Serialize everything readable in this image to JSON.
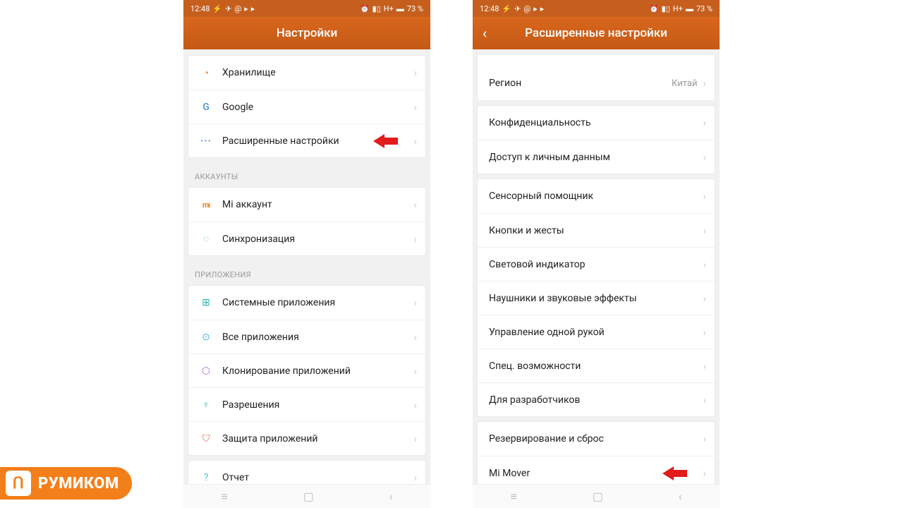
{
  "statusbar": {
    "time": "12:48",
    "net": "H+",
    "battery": "73 %"
  },
  "brand": {
    "text": "РУМИКОМ"
  },
  "left": {
    "title": "Настройки",
    "group1": [
      {
        "icon": "storage-icon",
        "glyph": "◔",
        "cls": "ic-orange",
        "label": "Хранилище"
      },
      {
        "icon": "google-icon",
        "glyph": "G",
        "cls": "ic-blue ic-google",
        "label": "Google"
      },
      {
        "icon": "more-icon",
        "glyph": "···",
        "cls": "ic-dots",
        "label": "Расширенные настройки",
        "arrow": true
      }
    ],
    "section_accounts": "АККАУНТЫ",
    "group2": [
      {
        "icon": "mi-icon",
        "glyph": "mı",
        "cls": "ic-mi",
        "label": "Mi аккаунт"
      },
      {
        "icon": "sync-icon",
        "glyph": "◌",
        "cls": "ic-cyan",
        "label": "Синхронизация"
      }
    ],
    "section_apps": "ПРИЛОЖЕНИЯ",
    "group3": [
      {
        "icon": "apps-icon",
        "glyph": "⊞",
        "cls": "ic-teal",
        "label": "Системные приложения"
      },
      {
        "icon": "allapps-icon",
        "glyph": "⊙",
        "cls": "ic-cyan",
        "label": "Все приложения"
      },
      {
        "icon": "clone-icon",
        "glyph": "⬡",
        "cls": "ic-purple",
        "label": "Клонирование приложений"
      },
      {
        "icon": "permissions-icon",
        "glyph": "♀",
        "cls": "ic-teal",
        "label": "Разрешения"
      },
      {
        "icon": "shield-icon",
        "glyph": "⛉",
        "cls": "ic-red",
        "label": "Защита приложений"
      }
    ],
    "group4": [
      {
        "icon": "report-icon",
        "glyph": "?",
        "cls": "ic-cyan",
        "label": "Отчет"
      }
    ]
  },
  "right": {
    "title": "Расширенные настройки",
    "group0": [
      {
        "label": "Регион",
        "value": "Китай"
      }
    ],
    "group1": [
      {
        "label": "Конфиденциальность"
      },
      {
        "label": "Доступ к личным данным"
      }
    ],
    "group2": [
      {
        "label": "Сенсорный помощник"
      },
      {
        "label": "Кнопки и жесты"
      },
      {
        "label": "Световой индикатор"
      },
      {
        "label": "Наушники и звуковые эффекты"
      },
      {
        "label": "Управление одной рукой"
      },
      {
        "label": "Спец. возможности"
      },
      {
        "label": "Для разработчиков"
      }
    ],
    "group3": [
      {
        "label": "Резервирование и сброс"
      },
      {
        "label": "Mi Mover",
        "arrow": true
      }
    ]
  }
}
